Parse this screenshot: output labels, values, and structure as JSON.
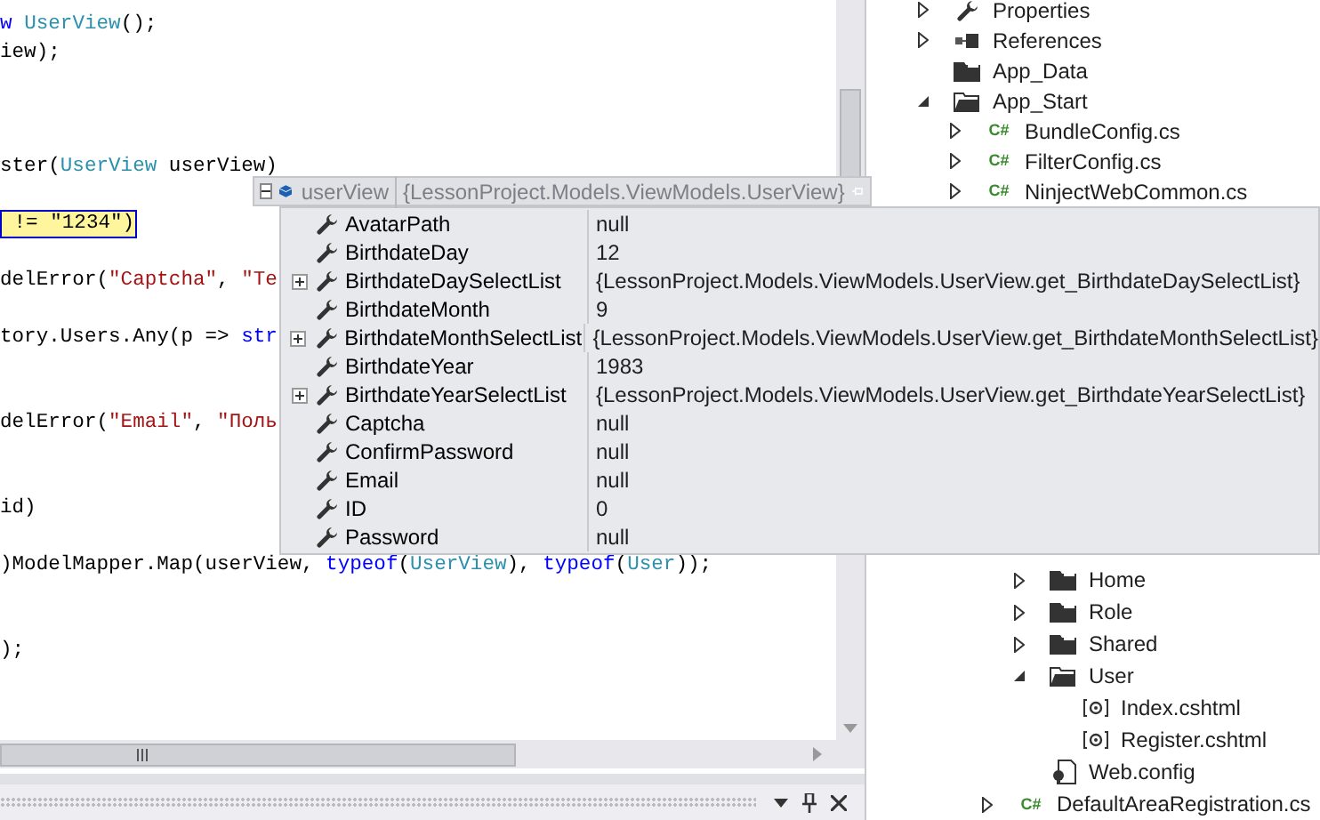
{
  "code_lines": [
    {
      "segments": [
        {
          "text": "w",
          "kind": "keyword"
        },
        {
          "text": "UserView",
          "kind": "type",
          "space_before": true
        },
        {
          "text": "();",
          "kind": "plain"
        }
      ]
    },
    {
      "segments": [
        {
          "text": "iew);",
          "kind": "plain"
        }
      ]
    },
    {
      "kind": "blank"
    },
    {
      "kind": "blank"
    },
    {
      "kind": "blank"
    },
    {
      "segments": [
        {
          "text": "ster(",
          "kind": "plain"
        },
        {
          "text": "UserView",
          "kind": "type"
        },
        {
          "text": " userView)",
          "kind": "plain"
        }
      ]
    },
    {
      "kind": "blank"
    },
    {
      "segments": [
        {
          "text": " != \"1234\")",
          "kind": "plain"
        }
      ],
      "highlighted": true
    },
    {
      "kind": "blank"
    },
    {
      "segments": [
        {
          "text": "delError(",
          "kind": "plain"
        },
        {
          "text": "\"Captcha\"",
          "kind": "string"
        },
        {
          "text": ", ",
          "kind": "plain"
        },
        {
          "text": "\"Te",
          "kind": "string"
        }
      ]
    },
    {
      "kind": "blank"
    },
    {
      "segments": [
        {
          "text": "tory.Users.Any(p => ",
          "kind": "plain"
        },
        {
          "text": "str",
          "kind": "keyword"
        }
      ]
    },
    {
      "kind": "blank"
    },
    {
      "kind": "blank"
    },
    {
      "segments": [
        {
          "text": "delError(",
          "kind": "plain"
        },
        {
          "text": "\"Email\"",
          "kind": "string"
        },
        {
          "text": ", ",
          "kind": "plain"
        },
        {
          "text": "\"Поль",
          "kind": "string"
        }
      ]
    },
    {
      "kind": "blank"
    },
    {
      "kind": "blank"
    },
    {
      "segments": [
        {
          "text": "id)",
          "kind": "plain"
        }
      ]
    },
    {
      "kind": "blank"
    },
    {
      "segments": [
        {
          "text": ")ModelMapper.Map(userView, ",
          "kind": "plain"
        },
        {
          "text": "typeof",
          "kind": "keyword"
        },
        {
          "text": "(",
          "kind": "plain"
        },
        {
          "text": "UserView",
          "kind": "type"
        },
        {
          "text": "), ",
          "kind": "plain"
        },
        {
          "text": "typeof",
          "kind": "keyword"
        },
        {
          "text": "(",
          "kind": "plain"
        },
        {
          "text": "User",
          "kind": "type"
        },
        {
          "text": "));",
          "kind": "plain"
        }
      ]
    },
    {
      "kind": "blank"
    },
    {
      "kind": "blank"
    },
    {
      "segments": [
        {
          "text": ");",
          "kind": "plain"
        }
      ]
    }
  ],
  "datatip": {
    "name": "userView",
    "value": "{LessonProject.Models.ViewModels.UserView}",
    "expanded": true,
    "rows": [
      {
        "name": "AvatarPath",
        "value": "null",
        "expandable": false
      },
      {
        "name": "BirthdateDay",
        "value": "12",
        "expandable": false
      },
      {
        "name": "BirthdateDaySelectList",
        "value": "{LessonProject.Models.ViewModels.UserView.get_BirthdateDaySelectList}",
        "expandable": true
      },
      {
        "name": "BirthdateMonth",
        "value": "9",
        "expandable": false
      },
      {
        "name": "BirthdateMonthSelectList",
        "value": "{LessonProject.Models.ViewModels.UserView.get_BirthdateMonthSelectList}",
        "expandable": true
      },
      {
        "name": "BirthdateYear",
        "value": "1983",
        "expandable": false
      },
      {
        "name": "BirthdateYearSelectList",
        "value": "{LessonProject.Models.ViewModels.UserView.get_BirthdateYearSelectList}",
        "expandable": true
      },
      {
        "name": "Captcha",
        "value": "null",
        "expandable": false
      },
      {
        "name": "ConfirmPassword",
        "value": "null",
        "expandable": false
      },
      {
        "name": "Email",
        "value": "null",
        "expandable": false
      },
      {
        "name": "ID",
        "value": "0",
        "expandable": false
      },
      {
        "name": "Password",
        "value": "null",
        "expandable": false
      }
    ]
  },
  "solution_tree_top": [
    {
      "label": "Properties",
      "kind": "properties",
      "expanded": false
    },
    {
      "label": "References",
      "kind": "references",
      "expanded": false
    },
    {
      "label": "App_Data",
      "kind": "folder"
    },
    {
      "label": "App_Start",
      "kind": "folder",
      "expanded": true,
      "children": [
        {
          "label": "BundleConfig.cs",
          "kind": "csharp",
          "icon_text": "C#",
          "expanded": false
        },
        {
          "label": "FilterConfig.cs",
          "kind": "csharp",
          "icon_text": "C#",
          "expanded": false
        },
        {
          "label": "NinjectWebCommon.cs",
          "kind": "csharp",
          "icon_text": "C#",
          "expanded": false
        }
      ]
    }
  ],
  "solution_tree_bottom": {
    "nested_items": [
      {
        "label": "Home",
        "kind": "folder",
        "expanded": false
      },
      {
        "label": "Role",
        "kind": "folder",
        "expanded": false
      },
      {
        "label": "Shared",
        "kind": "folder",
        "expanded": false
      },
      {
        "label": "User",
        "kind": "folder",
        "expanded": true,
        "children": [
          {
            "label": "Index.cshtml",
            "kind": "cshtml"
          },
          {
            "label": "Register.cshtml",
            "kind": "cshtml"
          }
        ]
      },
      {
        "label": "Web.config",
        "kind": "config"
      }
    ],
    "items": [
      {
        "label": "DefaultAreaRegistration.cs",
        "kind": "csharp",
        "icon_text": "C#",
        "expanded": false
      }
    ]
  }
}
